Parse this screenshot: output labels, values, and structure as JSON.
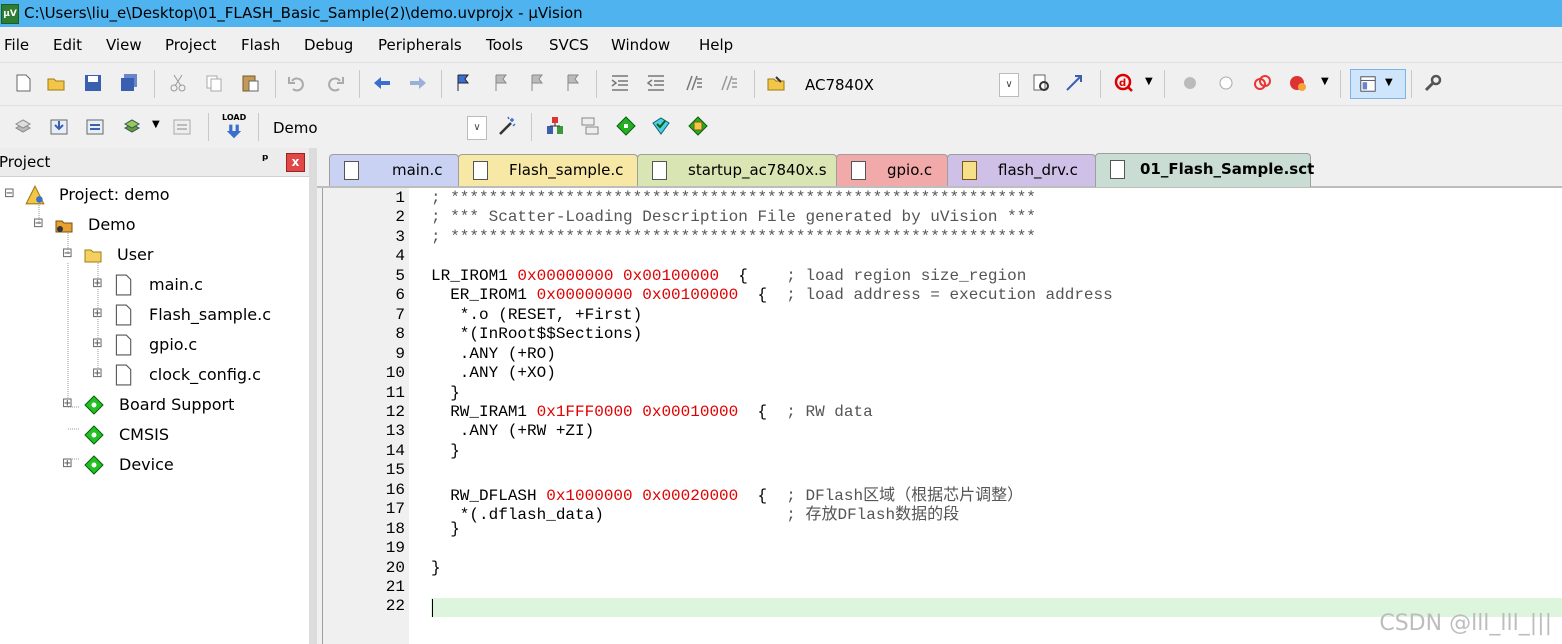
{
  "window": {
    "title": "C:\\Users\\liu_e\\Desktop\\01_FLASH_Basic_Sample(2)\\demo.uvprojx - µVision"
  },
  "menu": [
    "File",
    "Edit",
    "View",
    "Project",
    "Flash",
    "Debug",
    "Peripherals",
    "Tools",
    "SVCS",
    "Window",
    "Help"
  ],
  "toolbar": {
    "device_select": "AC7840X",
    "target_select": "Demo",
    "load_label": "LOAD"
  },
  "project_panel": {
    "title": "Project",
    "pin_glyph": "ᵖ",
    "close_glyph": "x",
    "tree": [
      {
        "label": "Project: demo",
        "level": 0,
        "icon": "project-icon",
        "expander": "⊟"
      },
      {
        "label": "Demo",
        "level": 1,
        "icon": "target-icon",
        "expander": "⊟"
      },
      {
        "label": "User",
        "level": 2,
        "icon": "folder-open-icon",
        "expander": "⊟"
      },
      {
        "label": "main.c",
        "level": 3,
        "icon": "file-icon",
        "expander": "⊞"
      },
      {
        "label": "Flash_sample.c",
        "level": 3,
        "icon": "file-icon",
        "expander": "⊞"
      },
      {
        "label": "gpio.c",
        "level": 3,
        "icon": "file-icon",
        "expander": "⊞"
      },
      {
        "label": "clock_config.c",
        "level": 3,
        "icon": "file-icon",
        "expander": "⊞"
      },
      {
        "label": "Board Support",
        "level": 2,
        "icon": "component-icon",
        "expander": "⊞"
      },
      {
        "label": "CMSIS",
        "level": 2,
        "icon": "component-icon",
        "expander": ""
      },
      {
        "label": "Device",
        "level": 2,
        "icon": "component-icon",
        "expander": "⊞"
      }
    ]
  },
  "tabs": [
    {
      "label": "main.c",
      "color": "#c9d2f2",
      "active": false
    },
    {
      "label": "Flash_sample.c",
      "color": "#f7e8a6",
      "active": false
    },
    {
      "label": "startup_ac7840x.s",
      "color": "#d9e6b3",
      "active": false
    },
    {
      "label": "gpio.c",
      "color": "#f2a9a9",
      "active": false
    },
    {
      "label": "flash_drv.c",
      "color": "#cfc0e8",
      "active": false
    },
    {
      "label": "01_Flash_Sample.sct",
      "color": "#c9ddd4",
      "active": true
    }
  ],
  "editor": {
    "lines": [
      [
        [
          "c",
          "; *************************************************************"
        ]
      ],
      [
        [
          "c",
          "; *** Scatter-Loading Description File generated by uVision ***"
        ]
      ],
      [
        [
          "c",
          "; *************************************************************"
        ]
      ],
      [],
      [
        [
          "t",
          "LR_IROM1 "
        ],
        [
          "n",
          "0x00000000 0x00100000"
        ],
        [
          "t",
          "  {    "
        ],
        [
          "c",
          "; load region size_region"
        ]
      ],
      [
        [
          "t",
          "  ER_IROM1 "
        ],
        [
          "n",
          "0x00000000 0x00100000"
        ],
        [
          "t",
          "  {  "
        ],
        [
          "c",
          "; load address = execution address"
        ]
      ],
      [
        [
          "t",
          "   *.o (RESET, +First)"
        ]
      ],
      [
        [
          "t",
          "   *(InRoot$$Sections)"
        ]
      ],
      [
        [
          "t",
          "   .ANY (+RO)"
        ]
      ],
      [
        [
          "t",
          "   .ANY (+XO)"
        ]
      ],
      [
        [
          "t",
          "  }"
        ]
      ],
      [
        [
          "t",
          "  RW_IRAM1 "
        ],
        [
          "n",
          "0x1FFF0000 0x00010000"
        ],
        [
          "t",
          "  {  "
        ],
        [
          "c",
          "; RW data"
        ]
      ],
      [
        [
          "t",
          "   .ANY (+RW +ZI)"
        ]
      ],
      [
        [
          "t",
          "  }"
        ]
      ],
      [],
      [
        [
          "t",
          "  RW_DFLASH "
        ],
        [
          "n",
          "0x1000000 0x00020000"
        ],
        [
          "t",
          "  {  "
        ],
        [
          "c",
          "; DFlash区域（根据芯片调整）"
        ]
      ],
      [
        [
          "t",
          "   *(.dflash_data)"
        ],
        [
          "t",
          "                   "
        ],
        [
          "c",
          "; 存放DFlash数据的段"
        ]
      ],
      [
        [
          "t",
          "  }"
        ]
      ],
      [],
      [
        [
          "t",
          "}"
        ]
      ],
      [],
      []
    ]
  },
  "watermark": "CSDN @lll_lll_|||",
  "colors": {
    "titlebar": "#4fb3f0",
    "number": "#e00000",
    "comment": "#555555"
  }
}
